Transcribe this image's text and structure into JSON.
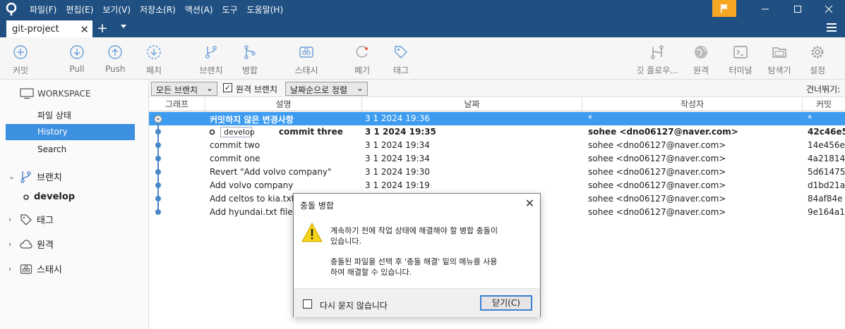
{
  "menu": [
    "파일(F)",
    "편집(E)",
    "보기(V)",
    "저장소(R)",
    "액션(A)",
    "도구",
    "도움말(H)"
  ],
  "tab": {
    "label": "git-project"
  },
  "toolbar": {
    "commit": "커밋",
    "pull": "Pull",
    "push": "Push",
    "fetch": "패치",
    "branch": "브랜치",
    "merge": "병합",
    "stash": "스태시",
    "discard": "폐기",
    "tag": "태그",
    "gitflow": "깃 플로우...",
    "remote": "원격",
    "terminal": "터미널",
    "explorer": "탐색기",
    "settings": "설정"
  },
  "sidebar": {
    "workspace": "WORKSPACE",
    "file_status": "파일 상태",
    "history": "History",
    "search": "Search",
    "branches": "브랜치",
    "develop": "develop",
    "tags": "태그",
    "remotes": "원격",
    "stashes": "스태시"
  },
  "filter": {
    "branches": "모든 브랜치",
    "remote_branches": "원격 브랜치",
    "sort": "날짜순으로 정렬",
    "jump": "건너뛰기:"
  },
  "columns": {
    "graph": "그래프",
    "desc": "설명",
    "date": "날짜",
    "author": "작성자",
    "commit": "커밋"
  },
  "rows": [
    {
      "desc": "커밋하지 않은 변경사항",
      "date": "3 1 2024 19:36",
      "author": "*",
      "commit": "*"
    },
    {
      "desc": "commit three",
      "date": "3 1 2024 19:35",
      "author": "sohee <dno06127@naver.com>",
      "commit": "42c46e5",
      "branch": "develop"
    },
    {
      "desc": "commit two",
      "date": "3 1 2024 19:34",
      "author": "sohee <dno06127@naver.com>",
      "commit": "14e456e"
    },
    {
      "desc": "commit one",
      "date": "3 1 2024 19:34",
      "author": "sohee <dno06127@naver.com>",
      "commit": "4a21814"
    },
    {
      "desc": "Revert \"Add volvo company\"",
      "date": "3 1 2024 19:30",
      "author": "sohee <dno06127@naver.com>",
      "commit": "5d61475"
    },
    {
      "desc": "Add volvo company",
      "date": "3 1 2024 19:19",
      "author": "sohee <dno06127@naver.com>",
      "commit": "d1bd21a"
    },
    {
      "desc": "Add celtos to kia.txt",
      "date": "",
      "author": "sohee <dno06127@naver.com>",
      "commit": "84af84e"
    },
    {
      "desc": "Add hyundai.txt file",
      "date": "",
      "author": "sohee <dno06127@naver.com>",
      "commit": "9e164a1"
    }
  ],
  "dialog": {
    "title": "충돌 병합",
    "line1": "계속하기 전에 작업 상태에 해결해야 할 병합 충돌이",
    "line2": "있습니다.",
    "line3": "충돌된 파일을 선택 후 '충돌 해결' 밑의 메뉴를 사용",
    "line4": "하여 해결할 수 있습니다.",
    "dont_ask": "다시 묻지 않습니다",
    "close": "닫기(C)"
  }
}
